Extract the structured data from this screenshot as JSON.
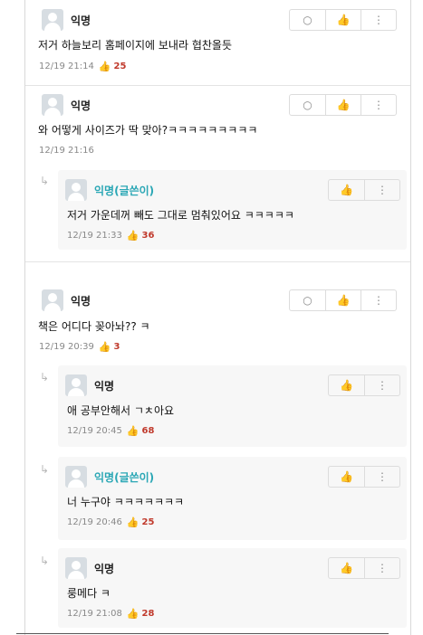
{
  "icons": {
    "reply": "speech-bubble-icon",
    "like": "thumb-up-icon",
    "more": "vertical-ellipsis-icon"
  },
  "colors": {
    "writer_name": "#2aa7b5",
    "like_count": "#c0392b"
  },
  "comments": [
    {
      "author": "익명",
      "text": "저거 하늘보리 홈페이지에 보내라 협찬올듯",
      "time": "12/19 21:14",
      "likes": "25"
    },
    {
      "author": "익명",
      "text": "와 어떻게 사이즈가 딱 맞아?ㅋㅋㅋㅋㅋㅋㅋㅋㅋ",
      "time": "12/19 21:16",
      "likes": "",
      "replies": [
        {
          "author": "익명(글쓴이)",
          "text": "저거 가운데꺼 빼도 그대로 멈춰있어요 ㅋㅋㅋㅋㅋ",
          "time": "12/19 21:33",
          "likes": "36"
        }
      ]
    },
    {
      "author": "익명",
      "text": "책은 어디다 꽂아놔?? ㅋ",
      "time": "12/19 20:39",
      "likes": "3",
      "replies": [
        {
          "author": "익명",
          "text": "애 공부안해서 ㄱㅊ아요",
          "time": "12/19 20:45",
          "likes": "68"
        },
        {
          "author": "익명(글쓴이)",
          "text": "너 누구야 ㅋㅋㅋㅋㅋㅋㅋ",
          "time": "12/19 20:46",
          "likes": "25"
        },
        {
          "author": "익명",
          "text": "룽메다 ㅋ",
          "time": "12/19 21:08",
          "likes": "28"
        }
      ]
    }
  ]
}
